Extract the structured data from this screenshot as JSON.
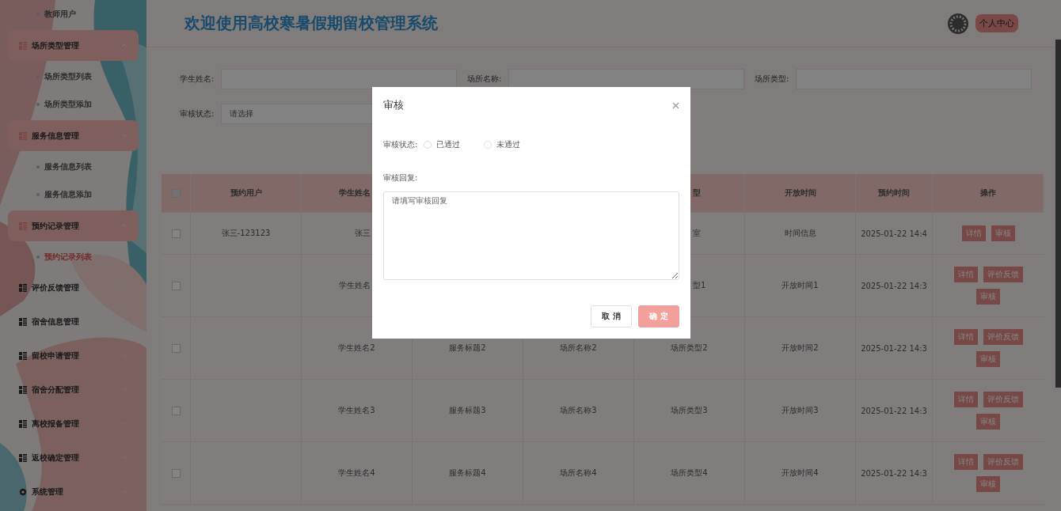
{
  "header": {
    "title": "欢迎使用高校寒暑假期留校管理系统",
    "user_button": "个人中心"
  },
  "sidebar": {
    "items": [
      {
        "kind": "sub",
        "label": "教师用户",
        "selected": false
      },
      {
        "kind": "group",
        "label": "场所类型管理",
        "expanded": true,
        "children": [
          {
            "label": "场所类型列表",
            "selected": false
          },
          {
            "label": "场所类型添加",
            "selected": false
          }
        ]
      },
      {
        "kind": "group",
        "label": "服务信息管理",
        "expanded": true,
        "children": [
          {
            "label": "服务信息列表",
            "selected": false
          },
          {
            "label": "服务信息添加",
            "selected": false
          }
        ]
      },
      {
        "kind": "group",
        "label": "预约记录管理",
        "expanded": true,
        "children": [
          {
            "label": "预约记录列表",
            "selected": true
          }
        ]
      },
      {
        "kind": "group",
        "label": "评价反馈管理",
        "expanded": false
      },
      {
        "kind": "group",
        "label": "宿舍信息管理",
        "expanded": false
      },
      {
        "kind": "group",
        "label": "留校申请管理",
        "expanded": false
      },
      {
        "kind": "group",
        "label": "宿舍分配管理",
        "expanded": false
      },
      {
        "kind": "group",
        "label": "离校报备管理",
        "expanded": false
      },
      {
        "kind": "group",
        "label": "返校确定管理",
        "expanded": false
      },
      {
        "kind": "settings",
        "label": "系统管理",
        "expanded": false
      }
    ]
  },
  "search": {
    "fields": [
      {
        "label": "学生姓名:",
        "kind": "input"
      },
      {
        "label": "场所名称:",
        "kind": "input"
      },
      {
        "label": "场所类型:",
        "kind": "input"
      },
      {
        "label": "审核状态:",
        "kind": "select",
        "placeholder": "请选择"
      }
    ]
  },
  "table": {
    "select_all": {
      "checked": false
    },
    "columns": [
      {
        "label": "预约用户"
      },
      {
        "label": "学生姓名"
      },
      null,
      null,
      {
        "label": "型"
      },
      {
        "label": "开放时间"
      },
      {
        "label": "预约时间"
      },
      {
        "label": "操作"
      }
    ],
    "rows": [
      {
        "checked": false,
        "cells": [
          {
            "text": "张三-123123"
          },
          {
            "text": "张三"
          },
          null,
          null,
          {
            "text": "室"
          },
          {
            "text": "时间信息"
          },
          {
            "text": "2025-01-22 14:4"
          }
        ],
        "actions": [
          "详情",
          "审核"
        ]
      },
      {
        "checked": false,
        "cells": [
          null,
          {
            "text": "学生姓名"
          },
          null,
          null,
          {
            "text": "型1"
          },
          {
            "text": "开放时间1"
          },
          {
            "text": "2025-01-22 14:3"
          }
        ],
        "actions": [
          "详情",
          "评价反馈",
          "审核"
        ]
      },
      {
        "checked": false,
        "cells": [
          null,
          {
            "text": "学生姓名2"
          },
          {
            "text": "服务标题2"
          },
          {
            "text": "场所名称2"
          },
          {
            "text": "场所类型2"
          },
          {
            "text": "开放时间2"
          },
          {
            "text": "2025-01-22 14:3"
          }
        ],
        "actions": [
          "详情",
          "评价反馈",
          "审核"
        ]
      },
      {
        "checked": false,
        "cells": [
          null,
          {
            "text": "学生姓名3"
          },
          {
            "text": "服务标题3"
          },
          {
            "text": "场所名称3"
          },
          {
            "text": "场所类型3"
          },
          {
            "text": "开放时间3"
          },
          {
            "text": "2025-01-22 14:3"
          }
        ],
        "actions": [
          "详情",
          "评价反馈",
          "审核"
        ]
      },
      {
        "checked": false,
        "cells": [
          null,
          {
            "text": "学生姓名4"
          },
          {
            "text": "服务标题4"
          },
          {
            "text": "场所名称4"
          },
          {
            "text": "场所类型4"
          },
          {
            "text": "开放时间4"
          },
          {
            "text": "2025-01-22 14:3"
          }
        ],
        "actions": [
          "详情",
          "评价反馈",
          "审核"
        ]
      }
    ]
  },
  "dialog": {
    "title": "审核",
    "status_label": "审核状态:",
    "options": [
      {
        "label": "已通过",
        "selected": false
      },
      {
        "label": "未通过",
        "selected": false
      }
    ],
    "reply_label": "审核回复:",
    "reply_placeholder": "请填写审核回复",
    "buttons": [
      {
        "label": "取 消",
        "kind": "default",
        "disabled": false
      },
      {
        "label": "确 定",
        "kind": "primary",
        "disabled": true
      }
    ]
  }
}
